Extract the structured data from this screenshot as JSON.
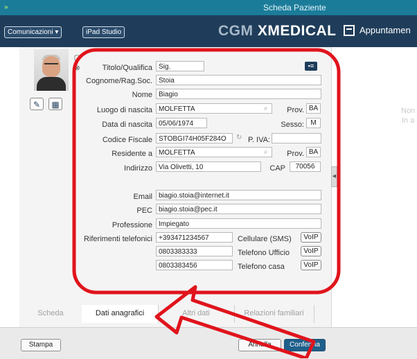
{
  "window": {
    "title": "Scheda Paziente",
    "app_icon": "xmedical-app-icon"
  },
  "toolbar": {
    "comunicazioni_label": "Comunicazioni ▾",
    "ipad_label": "iPad Studio",
    "brand_prefix": "CGM ",
    "brand_name": "XMEDICAL",
    "appointments_label": "Appuntamen"
  },
  "right_panel": {
    "line1": "Non",
    "line2": "In a"
  },
  "form": {
    "titolo": {
      "label": "Titolo/Qualifica",
      "value": "Sig."
    },
    "cognome": {
      "label": "Cognome/Rag.Soc.",
      "value": "Stoia"
    },
    "nome": {
      "label": "Nome",
      "value": "Biagio"
    },
    "luogo_nascita": {
      "label": "Luogo di nascita",
      "value": "MOLFETTA"
    },
    "prov_nascita": {
      "label": "Prov.",
      "value": "BA"
    },
    "data_nascita": {
      "label": "Data di nascita",
      "value": "05/06/1974"
    },
    "sesso": {
      "label": "Sesso:",
      "value": "M"
    },
    "codice_fiscale": {
      "label": "Codice Fiscale",
      "value": "STOBGI74H05F284O"
    },
    "piva": {
      "label": "P. IVA:",
      "value": ""
    },
    "residente": {
      "label": "Residente a",
      "value": "MOLFETTA"
    },
    "prov_residenza": {
      "label": "Prov.",
      "value": "BA"
    },
    "indirizzo": {
      "label": "Indirizzo",
      "value": "Via Olivetti, 10"
    },
    "cap": {
      "label": "CAP",
      "value": "70056"
    },
    "email": {
      "label": "Email",
      "value": "biagio.stoia@internet.it"
    },
    "pec": {
      "label": "PEC",
      "value": "biagio.stoia@pec.it"
    },
    "professione": {
      "label": "Professione",
      "value": "Impiegato"
    },
    "riferimenti_label": "Riferimenti telefonici",
    "phones": [
      {
        "number": "+393471234567",
        "type": "Cellulare (SMS)",
        "voip": "VoIP"
      },
      {
        "number": "0803383333",
        "type": "Telefono Ufficio",
        "voip": "VoIP"
      },
      {
        "number": "0803383456",
        "type": "Telefono casa",
        "voip": "VoIP"
      }
    ]
  },
  "tabs": [
    {
      "label": "Scheda",
      "active": false
    },
    {
      "label": "Dati anagrafici",
      "active": true
    },
    {
      "label": "Altri dati",
      "active": false
    },
    {
      "label": "Relazioni familiari",
      "active": false
    }
  ],
  "footer": {
    "print_label": "Stampa",
    "cancel_label": "Annulla",
    "confirm_label": "Conferma"
  },
  "colors": {
    "titlebar": "#1b7c9a",
    "toolbar": "#1f3d5a",
    "annotation": "#e0141c",
    "primary_button": "#1f5f8b"
  }
}
